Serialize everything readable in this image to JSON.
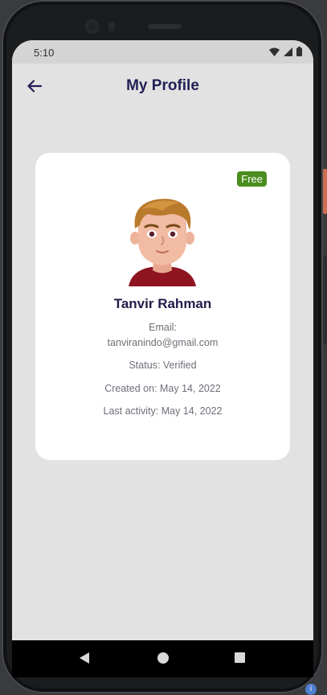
{
  "status_bar": {
    "time": "5:10"
  },
  "app_bar": {
    "title": "My Profile"
  },
  "profile": {
    "badge": "Free",
    "name": "Tanvir Rahman",
    "email_label": "Email:",
    "email": "tanviranindo@gmail.com",
    "status": "Status: Verified",
    "created": "Created on: May 14, 2022",
    "last_activity": "Last activity: May 14, 2022"
  },
  "icons": {
    "back": "arrow-back-icon",
    "wifi": "wifi-icon",
    "signal": "signal-icon",
    "battery": "battery-icon",
    "nav_back": "nav-back-icon",
    "nav_home": "nav-home-icon",
    "nav_recents": "nav-recents-icon"
  },
  "colors": {
    "title": "#221f55",
    "badge_bg": "#4b8d1f",
    "screen_bg": "#e2e2e2",
    "card_bg": "#ffffff"
  }
}
